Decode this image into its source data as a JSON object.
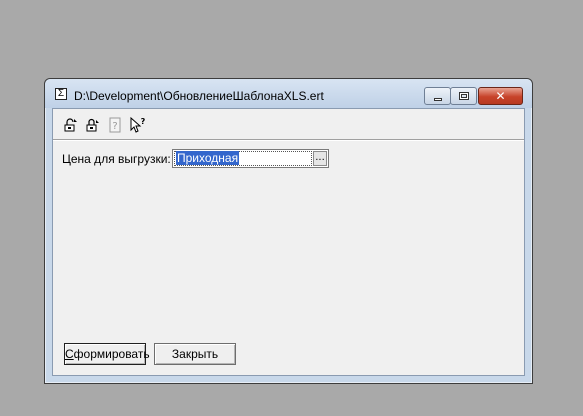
{
  "window": {
    "title": "D:\\Development\\ОбновлениеШаблонаXLS.ert",
    "app_icon_glyph": "Σ",
    "controls": {
      "minimize_label": "",
      "maximize_label": "",
      "close_glyph": "✕"
    }
  },
  "toolbar": {
    "items": [
      {
        "name": "lock-open-icon"
      },
      {
        "name": "lock-closed-icon"
      },
      {
        "name": "help-document-icon"
      },
      {
        "name": "whats-this-pointer-icon"
      }
    ]
  },
  "form": {
    "price_label": "Цена для выгрузки:",
    "price_value": "Приходная",
    "price_select_button": "..."
  },
  "buttons": {
    "generate_label_first": "С",
    "generate_label_rest": "формировать",
    "close_label": "Закрыть"
  },
  "colors": {
    "desktop": "#a9a9a9",
    "selection": "#3366cc",
    "close_button": "#c7432a"
  }
}
